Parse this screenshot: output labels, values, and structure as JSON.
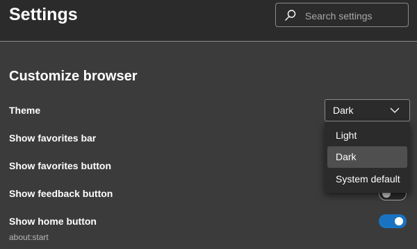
{
  "header": {
    "title": "Settings",
    "search_placeholder": "Search settings",
    "search_value": ""
  },
  "section": {
    "title": "Customize browser"
  },
  "settings": {
    "theme": {
      "label": "Theme",
      "selected_value": "Dark",
      "options": [
        "Light",
        "Dark",
        "System default"
      ],
      "dropdown_open": true
    },
    "favorites_bar": {
      "label": "Show favorites bar"
    },
    "favorites_button": {
      "label": "Show favorites button"
    },
    "feedback_button": {
      "label": "Show feedback button",
      "enabled": false
    },
    "home_button": {
      "label": "Show home button",
      "sublabel": "about:start",
      "enabled": true
    }
  },
  "colors": {
    "background": "#3b3b3b",
    "header_background": "#2b2b2b",
    "accent": "#1a73c2",
    "selected_option": "#4f4f4f"
  },
  "icons": {
    "search": "search-icon",
    "chevron": "chevron-down-icon"
  }
}
